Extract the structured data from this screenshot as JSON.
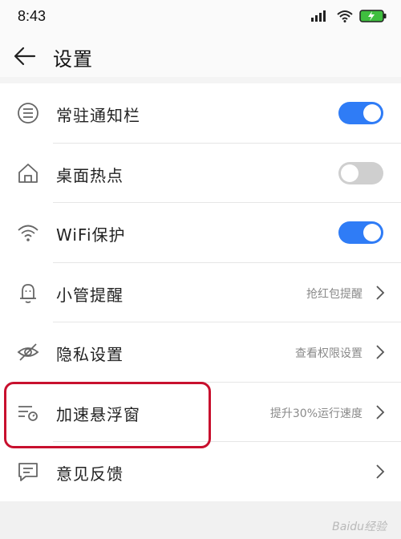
{
  "status_bar": {
    "time": "8:43",
    "icons": [
      "signal-icon",
      "wifi-icon",
      "battery-charging-icon"
    ],
    "battery_color": "#3fbf3f"
  },
  "header": {
    "back_icon": "arrow-left-icon",
    "title": "设置"
  },
  "colors": {
    "accent": "#2f7cf6",
    "toggle_off": "#cfcfcf",
    "highlight": "#c8102e"
  },
  "settings": [
    {
      "icon": "list-circle-icon",
      "label": "常驻通知栏",
      "control": "toggle",
      "on": true
    },
    {
      "icon": "home-icon",
      "label": "桌面热点",
      "control": "toggle",
      "on": false
    },
    {
      "icon": "wifi-icon",
      "label": "WiFi保护",
      "control": "toggle",
      "on": true
    },
    {
      "icon": "bell-person-icon",
      "label": "小管提醒",
      "control": "link",
      "value": "抢红包提醒"
    },
    {
      "icon": "eye-off-icon",
      "label": "隐私设置",
      "control": "link",
      "value": "查看权限设置"
    },
    {
      "icon": "speed-list-icon",
      "label": "加速悬浮窗",
      "control": "link",
      "value": "提升30%运行速度",
      "highlighted": true
    },
    {
      "icon": "feedback-icon",
      "label": "意见反馈",
      "control": "link",
      "value": ""
    }
  ],
  "watermark": "Baidu经验"
}
